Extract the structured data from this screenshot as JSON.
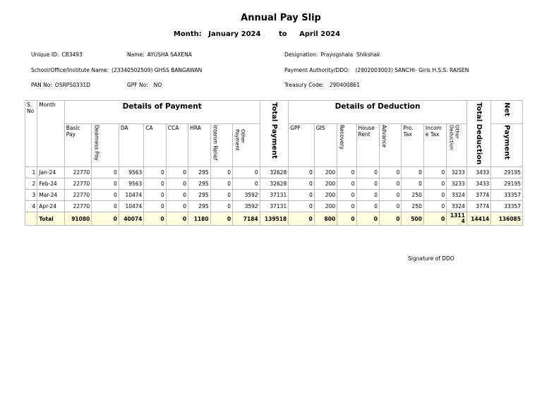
{
  "title": "Annual Pay Slip",
  "period": {
    "month_label": "Month:",
    "from": "January 2024",
    "to_label": "to",
    "to": "April 2024"
  },
  "info": {
    "unique_id_label": "Unique ID:",
    "unique_id": "CB3493",
    "name_label": "Name:",
    "name": "AYUSHA SAXENA",
    "designation_label": "Designation:",
    "designation": "Prayogshala  Shikshak",
    "school_label": "School/Office/Institute Name:",
    "school": "(23340502509) GHSS BANGAWAN",
    "authority_label": "Payment Authority/DDO:",
    "authority": "(2902003003) SANCHI- Girls H.S.S. RAISEN",
    "pan_label": "PAN No:",
    "pan": "OSRPS0331D",
    "gpf_label": "GPF No:",
    "gpf": "NO",
    "treasury_label": "Treasury Code:",
    "treasury": "290400861"
  },
  "table": {
    "sno_header": "S.\nNo",
    "month_header": "Month",
    "payment_group": "Details of Payment",
    "deduction_group": "Details of Deduction",
    "total_payment_header": "Total Payment",
    "total_deduction_header": "Total Deduction",
    "net_header_1": "Net",
    "net_header_2": "Payment",
    "payment_columns": [
      "Basic Pay",
      "Dearness Pay",
      "DA",
      "CA",
      "CCA",
      "HRA",
      "Interim Relief",
      "Other Payment"
    ],
    "deduction_columns": [
      "GPF",
      "GIS",
      "Recovery",
      "House Rent",
      "Advance",
      "Pro. Tax",
      "Income Tax",
      "Other Deduction"
    ],
    "rows": [
      {
        "sno": "1",
        "month": "Jan-24",
        "pay": [
          "22770",
          "0",
          "9563",
          "0",
          "0",
          "295",
          "0",
          "0"
        ],
        "total_pay": "32628",
        "ded": [
          "0",
          "200",
          "0",
          "0",
          "0",
          "0",
          "0",
          "3233"
        ],
        "total_ded": "3433",
        "net": "29195"
      },
      {
        "sno": "2",
        "month": "Feb-24",
        "pay": [
          "22770",
          "0",
          "9563",
          "0",
          "0",
          "295",
          "0",
          "0"
        ],
        "total_pay": "32628",
        "ded": [
          "0",
          "200",
          "0",
          "0",
          "0",
          "0",
          "0",
          "3233"
        ],
        "total_ded": "3433",
        "net": "29195"
      },
      {
        "sno": "3",
        "month": "Mar-24",
        "pay": [
          "22770",
          "0",
          "10474",
          "0",
          "0",
          "295",
          "0",
          "3592"
        ],
        "total_pay": "37131",
        "ded": [
          "0",
          "200",
          "0",
          "0",
          "0",
          "250",
          "0",
          "3324"
        ],
        "total_ded": "3774",
        "net": "33357"
      },
      {
        "sno": "4",
        "month": "Apr-24",
        "pay": [
          "22770",
          "0",
          "10474",
          "0",
          "0",
          "295",
          "0",
          "3592"
        ],
        "total_pay": "37131",
        "ded": [
          "0",
          "200",
          "0",
          "0",
          "0",
          "250",
          "0",
          "3324"
        ],
        "total_ded": "3774",
        "net": "33357"
      }
    ],
    "total": {
      "label": "Total",
      "pay": [
        "91080",
        "0",
        "40074",
        "0",
        "0",
        "1180",
        "0",
        "7184"
      ],
      "total_pay": "139518",
      "ded": [
        "0",
        "800",
        "0",
        "0",
        "0",
        "500",
        "0",
        "13114"
      ],
      "total_ded": "14414",
      "net": "136085"
    }
  },
  "signature": "Signature of DDO"
}
